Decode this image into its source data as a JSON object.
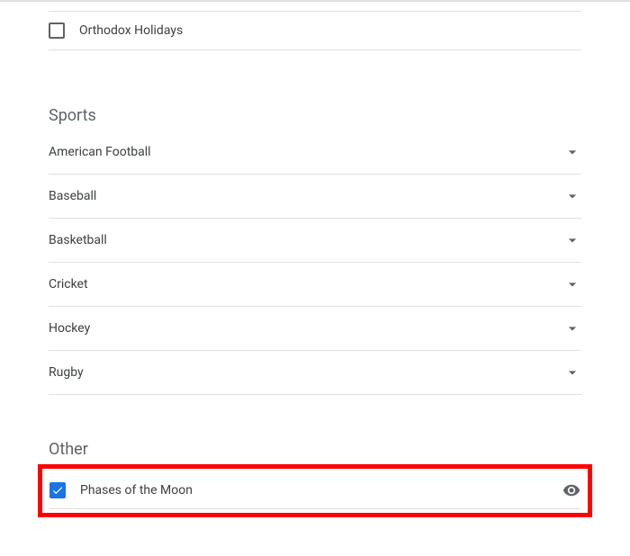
{
  "top_item": {
    "label": "Orthodox Holidays",
    "checked": false
  },
  "sections": {
    "sports": {
      "title": "Sports",
      "items": [
        {
          "label": "American Football"
        },
        {
          "label": "Baseball"
        },
        {
          "label": "Basketball"
        },
        {
          "label": "Cricket"
        },
        {
          "label": "Hockey"
        },
        {
          "label": "Rugby"
        }
      ]
    },
    "other": {
      "title": "Other",
      "items": [
        {
          "label": "Phases of the Moon",
          "checked": true
        }
      ]
    }
  }
}
